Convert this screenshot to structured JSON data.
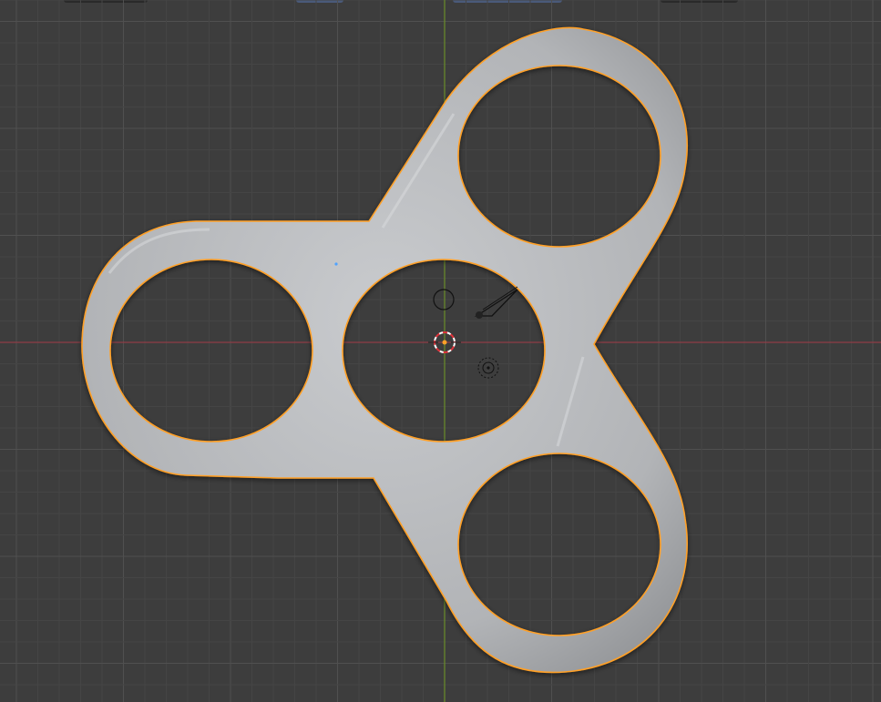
{
  "viewport": {
    "view": "top-orthographic",
    "grid": true,
    "colors": {
      "background": "#3d3d3d",
      "grid_minor": "#454545",
      "grid_major": "#505050",
      "x_axis": "#8f3d46",
      "y_axis": "#6a8d2a",
      "selection_outline": "#ffa028",
      "mesh_fill": "#b7b9bc"
    }
  },
  "scene_objects": [
    {
      "name": "fidget-spinner-mesh",
      "icon": "mesh-object",
      "selected": true
    },
    {
      "name": "camera",
      "icon": "camera-icon"
    },
    {
      "name": "light",
      "icon": "light-icon"
    },
    {
      "name": "origin",
      "icon": "origin-dot"
    },
    {
      "name": "3d-cursor",
      "icon": "crosshair-cursor"
    }
  ],
  "header": {
    "tabs": [
      "",
      "",
      ""
    ]
  }
}
